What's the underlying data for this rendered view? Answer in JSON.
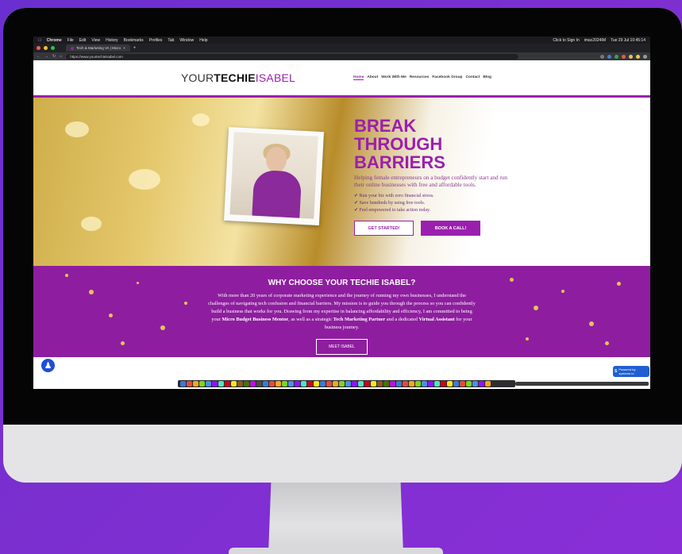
{
  "menubar": {
    "app": "Chrome",
    "items": [
      "File",
      "Edit",
      "View",
      "History",
      "Bookmarks",
      "Profiles",
      "Tab",
      "Window",
      "Help"
    ],
    "sign_in": "Click to Sign In",
    "device": "imac2024IM",
    "clock": "Tue 29 Jul 10:45:14"
  },
  "browser": {
    "tab_title": "Tech & Marketing VA | Micro",
    "url": "https://www.yourtechieisabel.com"
  },
  "site": {
    "logo_your": "YOUR",
    "logo_techie": "TECHIE",
    "logo_isabel": "ISABEL",
    "nav": [
      "Home",
      "About",
      "Work With Me",
      "Resources",
      "Facebook Group",
      "Contact",
      "Blog"
    ],
    "hero": {
      "headline_lines": [
        "BREAK",
        "THROUGH",
        "BARRIERS"
      ],
      "subtitle": "Helping female entrepreneurs on a budget confidently start and run their online businesses with free and affordable tools.",
      "bullets": [
        "✔ Run your biz with zero financial stress.",
        "✔ Save hundreds by using free tools.",
        "✔ Feel empowered to take action today."
      ],
      "btn_start": "GET STARTED!",
      "btn_call": "BOOK A CALL!"
    },
    "why": {
      "title": "WHY CHOOSE YOUR TECHIE ISABEL?",
      "p_part1": "With more than 20 years of corporate marketing experience and the journey of running my own businesses, I understand the challenges of navigating tech confusion and financial barriers. My mission is to guide you through the process so you can confidently build a business that works for you. Drawing from my expertise in balancing affordability and efficiency, I am committed to being your ",
      "p_bold1": "Micro Budget Business Mentor",
      "p_part2": ", as well as a strategic ",
      "p_bold2": "Tech Marketing Partner",
      "p_part3": " and a dedicated ",
      "p_bold3": "Virtual Assistant",
      "p_part4": " for your business journey.",
      "button": "MEET ISABEL"
    },
    "badge": "Powered by systeme.io"
  },
  "colors": {
    "brand_purple": "#9b1fae",
    "why_bg": "#8e1e9f",
    "background": "#7b2fcf"
  }
}
